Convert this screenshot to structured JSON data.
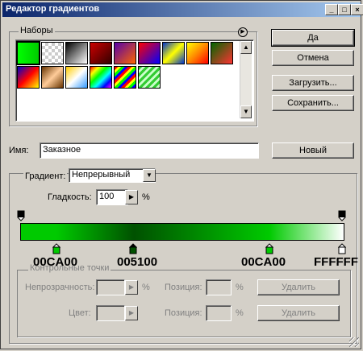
{
  "window": {
    "title": "Редактор градиентов"
  },
  "titlebar_buttons": [
    "_",
    "□",
    "×"
  ],
  "buttons": {
    "ok": "Да",
    "cancel": "Отмена",
    "load": "Загрузить...",
    "save": "Сохранить...",
    "new": "Новый",
    "delete1": "Удалить",
    "delete2": "Удалить"
  },
  "presets": {
    "label": "Наборы",
    "swatches": [
      "linear-gradient(90deg,#00ff00,#00cc00)",
      "repeating-conic-gradient(#ccc 0 25%,#fff 0 50%) 0 0/8px 8px",
      "linear-gradient(135deg,#000,#fff)",
      "linear-gradient(135deg,#cc0000,#330000)",
      "linear-gradient(135deg,#5500aa,#ff6600)",
      "linear-gradient(135deg,#ff0000,#0000ff)",
      "linear-gradient(135deg,#0033cc,#ffff00,#0033cc)",
      "linear-gradient(135deg,#ffff00,#ff8800,#ff0000)",
      "linear-gradient(135deg,#006600,#ff3333)",
      "linear-gradient(135deg,#0000cc,#ff0000,#ffff00)",
      "linear-gradient(135deg,#663300,#ffcc99,#663300)",
      "linear-gradient(135deg,#ffcc00,#ffffff,#3399ff)",
      "linear-gradient(135deg,#ff0000,#ffff00,#00ff00,#00ffff,#0000ff,#ff00ff)",
      "repeating-linear-gradient(135deg,#ff0000 0 3px,#ffff00 3px 6px,#00ff00 6px 9px,#0000ff 9px 12px)",
      "repeating-linear-gradient(135deg,#33cc33 0 3px,#ccffcc 3px 6px)"
    ]
  },
  "name": {
    "label": "Имя:",
    "value": "Заказное"
  },
  "gradient_type": {
    "label": "Градиент:",
    "value": "Непрерывный"
  },
  "smoothness": {
    "label": "Гладкость:",
    "value": "100",
    "unit": "%"
  },
  "gradient_colors": [
    "#00ca00",
    "#005100",
    "#00ca00",
    "#ffffff"
  ],
  "stop_labels": [
    "00CA00",
    "005100",
    "00CA00",
    "FFFFFF"
  ],
  "stops_group": {
    "label": "Контрольные точки",
    "opacity_label": "Непрозрачность:",
    "percent1": "%",
    "position_label1": "Позиция:",
    "percent2": "%",
    "color_label": "Цвет:",
    "position_label2": "Позиция:",
    "percent3": "%"
  },
  "colors": {
    "titlebar_start": "#0a246a",
    "titlebar_end": "#a6caf0",
    "face": "#d4d0c8"
  }
}
